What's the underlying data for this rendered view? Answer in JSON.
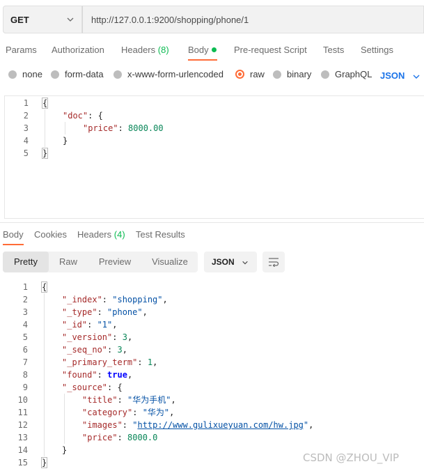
{
  "request": {
    "method": "GET",
    "url": "http://127.0.0.1:9200/shopping/phone/1"
  },
  "request_tabs": [
    {
      "label": "Params"
    },
    {
      "label": "Authorization"
    },
    {
      "label": "Headers",
      "count": "(8)"
    },
    {
      "label": "Body"
    },
    {
      "label": "Pre-request Script"
    },
    {
      "label": "Tests"
    },
    {
      "label": "Settings"
    }
  ],
  "body_types": [
    {
      "label": "none",
      "selected": false
    },
    {
      "label": "form-data",
      "selected": false
    },
    {
      "label": "x-www-form-urlencoded",
      "selected": false
    },
    {
      "label": "raw",
      "selected": true
    },
    {
      "label": "binary",
      "selected": false
    },
    {
      "label": "GraphQL",
      "selected": false
    }
  ],
  "raw_format": "JSON",
  "request_body_lines": [
    "1",
    "2",
    "3",
    "4",
    "5"
  ],
  "request_body": {
    "l1": "{",
    "l2_key": "\"doc\"",
    "l2_rest": ": {",
    "l3_key": "\"price\"",
    "l3_colon": ": ",
    "l3_val": "8000.00",
    "l4": "}",
    "l5": "}"
  },
  "response_tabs": [
    {
      "label": "Body"
    },
    {
      "label": "Cookies"
    },
    {
      "label": "Headers",
      "count": "(4)"
    },
    {
      "label": "Test Results"
    }
  ],
  "view_modes": [
    {
      "label": "Pretty",
      "selected": true
    },
    {
      "label": "Raw"
    },
    {
      "label": "Preview"
    },
    {
      "label": "Visualize"
    }
  ],
  "response_format": "JSON",
  "response_body_lines": [
    "1",
    "2",
    "3",
    "4",
    "5",
    "6",
    "7",
    "8",
    "9",
    "10",
    "11",
    "12",
    "13",
    "14",
    "15"
  ],
  "response_body": {
    "index_key": "\"_index\"",
    "index_val": "\"shopping\"",
    "type_key": "\"_type\"",
    "type_val": "\"phone\"",
    "id_key": "\"_id\"",
    "id_val": "\"1\"",
    "version_key": "\"_version\"",
    "version_val": "3",
    "seq_key": "\"_seq_no\"",
    "seq_val": "3",
    "term_key": "\"_primary_term\"",
    "term_val": "1",
    "found_key": "\"found\"",
    "found_val": "true",
    "source_key": "\"_source\"",
    "title_key": "\"title\"",
    "title_val": "\"华为手机\"",
    "category_key": "\"category\"",
    "category_val": "\"华为\"",
    "images_key": "\"images\"",
    "images_q1": "\"",
    "images_url": "http://www.gulixueyuan.com/hw.jpg",
    "images_q2": "\"",
    "price_key": "\"price\"",
    "price_val": "8000.0"
  },
  "watermark": "CSDN @ZHOU_VIP",
  "colors": {
    "accent": "#ff6c37",
    "green": "#0cbb52",
    "link": "#1a73e8"
  }
}
